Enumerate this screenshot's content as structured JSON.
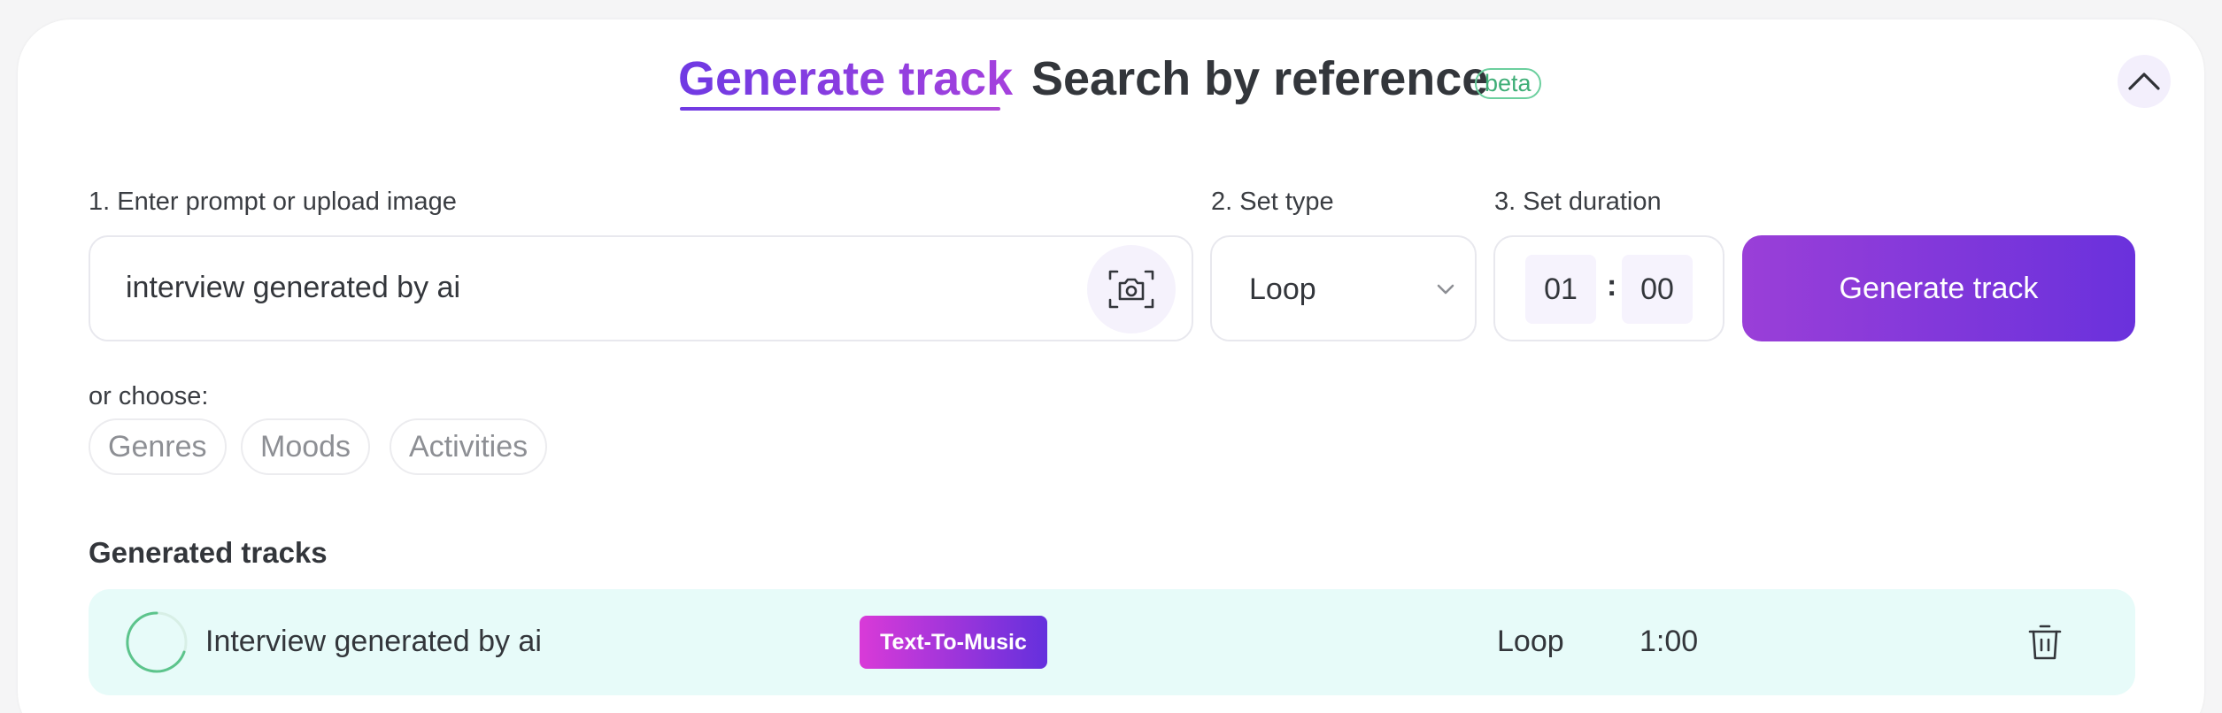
{
  "tabs": {
    "generate_label": "Generate track",
    "search_label": "Search by reference",
    "search_badge": "beta"
  },
  "form": {
    "prompt_label": "1. Enter prompt or upload image",
    "prompt_value": "interview generated by ai",
    "type_label": "2. Set type",
    "type_value": "Loop",
    "duration_label": "3. Set duration",
    "duration_minutes": "01",
    "duration_separator": ":",
    "duration_seconds": "00",
    "generate_button": "Generate track"
  },
  "choose": {
    "label": "or choose:",
    "chips": [
      "Genres",
      "Moods",
      "Activities"
    ]
  },
  "generated": {
    "title": "Generated tracks",
    "tracks": [
      {
        "title": "Interview generated by ai",
        "badge": "Text-To-Music",
        "type": "Loop",
        "duration": "1:00",
        "status": "generating"
      }
    ]
  },
  "icons": {
    "collapse": "chevron-up-icon",
    "camera": "camera-icon",
    "dropdown": "chevron-down-icon",
    "spinner": "loading-spinner-icon",
    "delete": "trash-icon"
  },
  "colors": {
    "accent_start": "#9a3fd8",
    "accent_end": "#6a31dc",
    "beta": "#3fae77",
    "track_row_bg": "#e7fbf9"
  }
}
